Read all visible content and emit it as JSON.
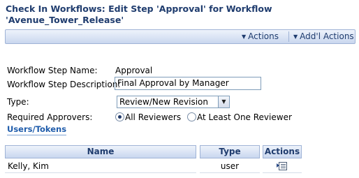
{
  "page": {
    "title_line1": "Check In Workflows: Edit Step 'Approval' for Workflow",
    "title_line2": "'Avenue_Tower_Release'"
  },
  "actionbar": {
    "actions_label": "Actions",
    "addl_actions_label": "Add'l Actions"
  },
  "form": {
    "step_name_label": "Workflow Step Name:",
    "step_name_value": "Approval",
    "step_desc_label": "Workflow Step Description:",
    "step_desc_value": "Final Approval by Manager",
    "type_label": "Type:",
    "type_value": "Review/New Revision",
    "approvers_label": "Required Approvers:",
    "approvers_option_all": "All Reviewers",
    "approvers_option_one": "At Least One Reviewer",
    "approvers_selected": "All Reviewers"
  },
  "users_section": {
    "title": "Users/Tokens"
  },
  "table": {
    "headers": [
      "Name",
      "Type",
      "Actions"
    ],
    "rows": [
      {
        "name": "Kelly, Kim",
        "type": "user",
        "action_icon": "edit-list-icon"
      }
    ]
  },
  "colors": {
    "title": "#1f3c6e",
    "link": "#1f5cab",
    "bar_border": "#9fb3d6"
  }
}
